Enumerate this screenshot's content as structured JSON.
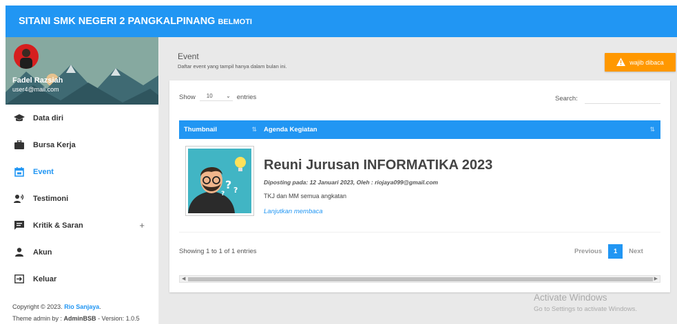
{
  "header": {
    "brand": "SITANI SMK NEGERI 2 PANGKALPINANG",
    "brand_sub": "BELMOTI"
  },
  "user": {
    "name": "Fadel Razsiah",
    "email": "user4@mail.com"
  },
  "sidebar": {
    "items": [
      {
        "label": "Data diri",
        "icon": "graduation-cap-icon"
      },
      {
        "label": "Bursa Kerja",
        "icon": "briefcase-icon"
      },
      {
        "label": "Event",
        "icon": "calendar-icon",
        "active": true
      },
      {
        "label": "Testimoni",
        "icon": "record-voice-icon"
      },
      {
        "label": "Kritik & Saran",
        "icon": "feedback-icon",
        "expand": "+"
      },
      {
        "label": "Akun",
        "icon": "person-icon"
      },
      {
        "label": "Keluar",
        "icon": "logout-icon"
      }
    ]
  },
  "footer": {
    "copyright": "Copyright © 2023.",
    "author": "Rio Sanjaya",
    "theme_prefix": "Theme admin by :",
    "theme_name": "AdminBSB",
    "version": "- Version: 1.0.5"
  },
  "page": {
    "title": "Event",
    "subtitle": "Daftar event yang tampil hanya dalam bulan ini.",
    "warning_button": "wajib dibaca"
  },
  "table": {
    "show_label": "Show",
    "entries_value": "10",
    "entries_label": "entries",
    "search_label": "Search:",
    "columns": [
      "Thumbnail",
      "Agenda Kegiatan"
    ],
    "rows": [
      {
        "title": "Reuni Jurusan INFORMATIKA 2023",
        "meta": "Diposting pada: 12 Januari 2023, Oleh : riojaya099@gmail.com",
        "description": "TKJ dan MM semua angkatan",
        "link": "Lanjutkan membaca"
      }
    ],
    "info": "Showing 1 to 1 of 1 entries",
    "pager": {
      "previous": "Previous",
      "current": "1",
      "next": "Next"
    }
  },
  "watermark": {
    "line1": "Activate Windows",
    "line2": "Go to Settings to activate Windows."
  },
  "colors": {
    "primary": "#2196f3",
    "warning": "#ff9800",
    "background": "#e9e9e9"
  }
}
